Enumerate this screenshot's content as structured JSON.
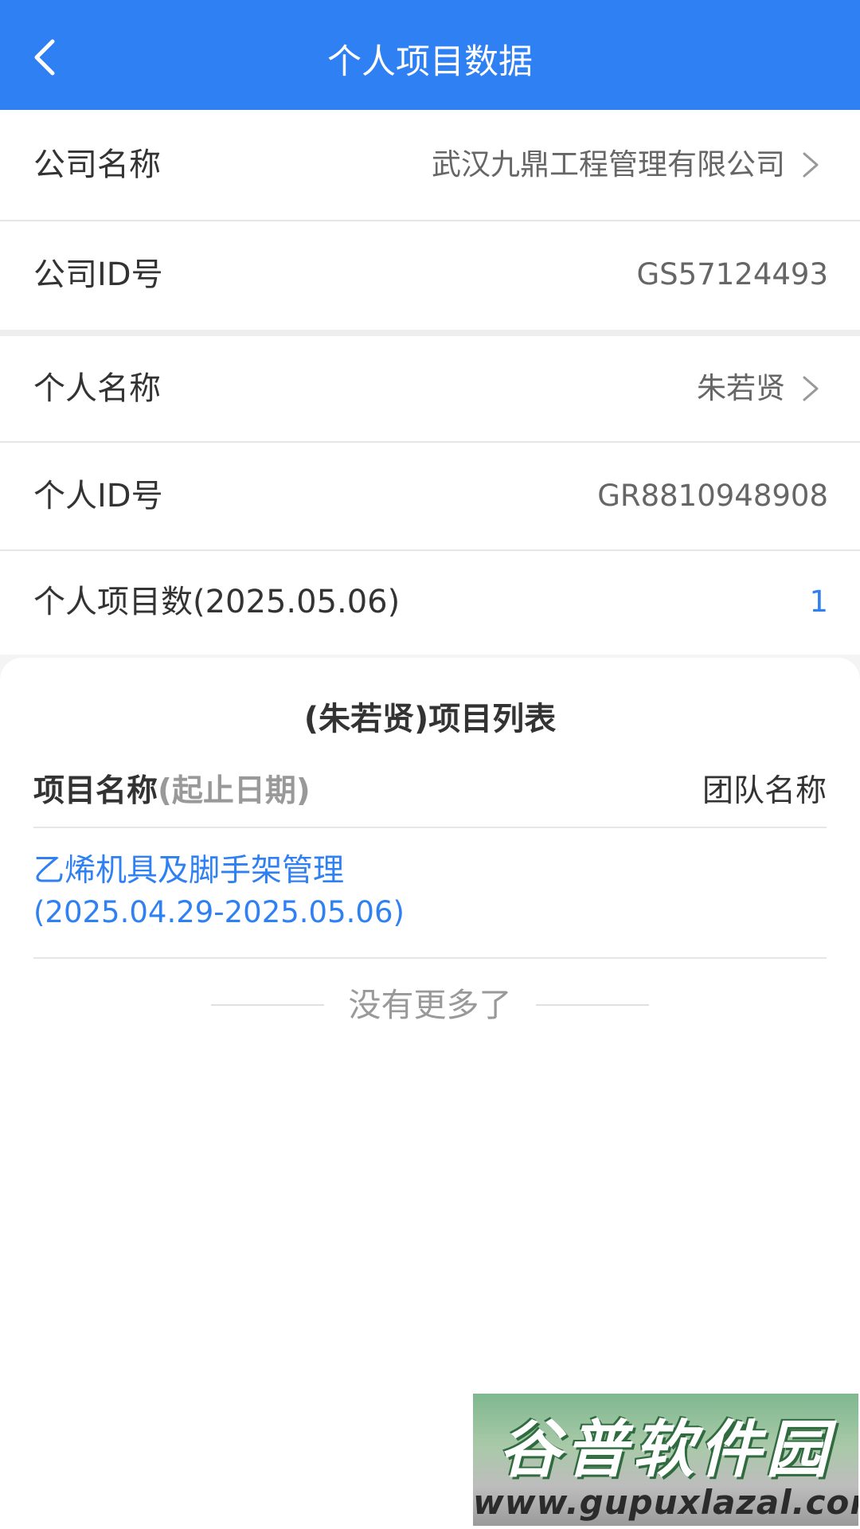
{
  "header": {
    "title": "个人项目数据"
  },
  "company": {
    "name_label": "公司名称",
    "name_value": "武汉九鼎工程管理有限公司",
    "id_label": "公司ID号",
    "id_value": "GS57124493"
  },
  "person": {
    "name_label": "个人名称",
    "name_value": "朱若贤",
    "id_label": "个人ID号",
    "id_value": "GR8810948908",
    "count_label": "个人项目数(2025.05.06)",
    "count_value": "1"
  },
  "project_list": {
    "title": "(朱若贤)项目列表",
    "col_name": "项目名称",
    "col_dates": "(起止日期)",
    "col_team": "团队名称",
    "items": [
      {
        "name": "乙烯机具及脚手架管理",
        "dates": "(2025.04.29-2025.05.06)"
      }
    ],
    "end_text": "没有更多了"
  },
  "watermark": {
    "cn": "谷普软件园",
    "url": "www.gupuxlazal.com"
  },
  "colors": {
    "primary": "#2f80f3",
    "text": "#333333",
    "muted": "#999999",
    "value": "#666666"
  }
}
